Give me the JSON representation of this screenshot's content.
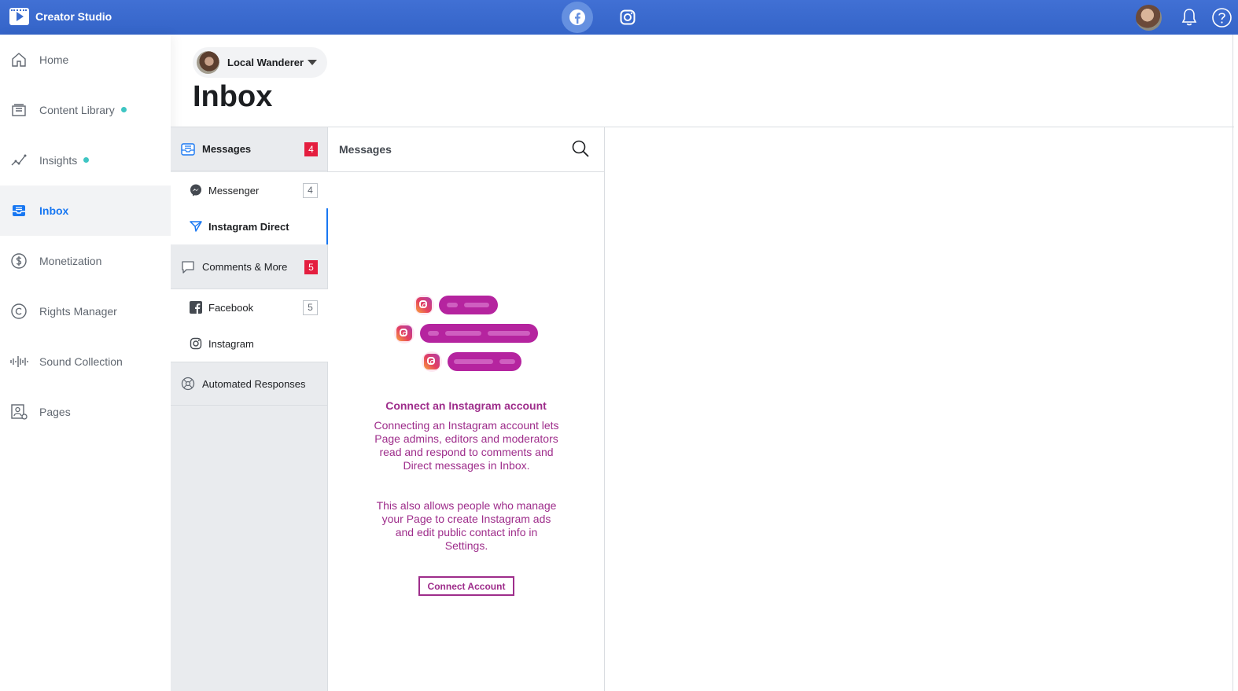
{
  "app": {
    "title": "Creator Studio"
  },
  "topbar": {
    "platforms": [
      "facebook-icon",
      "instagram-icon"
    ],
    "active_platform": "facebook"
  },
  "sidebar": {
    "items": [
      {
        "label": "Home",
        "icon": "home-icon",
        "dot": false
      },
      {
        "label": "Content Library",
        "icon": "library-icon",
        "dot": true
      },
      {
        "label": "Insights",
        "icon": "insights-icon",
        "dot": true
      },
      {
        "label": "Inbox",
        "icon": "inbox-icon",
        "dot": false,
        "active": true
      },
      {
        "label": "Monetization",
        "icon": "dollar-icon",
        "dot": false
      },
      {
        "label": "Rights Manager",
        "icon": "copyright-icon",
        "dot": false
      },
      {
        "label": "Sound Collection",
        "icon": "soundwave-icon",
        "dot": false
      },
      {
        "label": "Pages",
        "icon": "pages-icon",
        "dot": false
      }
    ],
    "dot_color": "#3ec5c3"
  },
  "header": {
    "page_name": "Local Wanderer",
    "title": "Inbox"
  },
  "folders": {
    "messages": {
      "label": "Messages",
      "count": "4"
    },
    "messages_items": [
      {
        "label": "Messenger",
        "count": "4"
      },
      {
        "label": "Instagram Direct",
        "active": true
      }
    ],
    "comments": {
      "label": "Comments & More",
      "count": "5"
    },
    "comments_items": [
      {
        "label": "Facebook",
        "count": "5"
      },
      {
        "label": "Instagram"
      }
    ],
    "automated": {
      "label": "Automated Responses"
    }
  },
  "list": {
    "title": "Messages"
  },
  "empty_state": {
    "title": "Connect an Instagram account",
    "body1": "Connecting an Instagram account lets Page admins, editors and moderators read and respond to comments and Direct messages in Inbox.",
    "body2": "This also allows people who manage your Page to create Instagram ads and edit public contact info in Settings.",
    "button": "Connect Account",
    "accent_color": "#9e2d8b"
  },
  "colors": {
    "topbar": "#3a6ccf",
    "active_blue": "#1877f2",
    "badge_red": "#e41e3f"
  }
}
